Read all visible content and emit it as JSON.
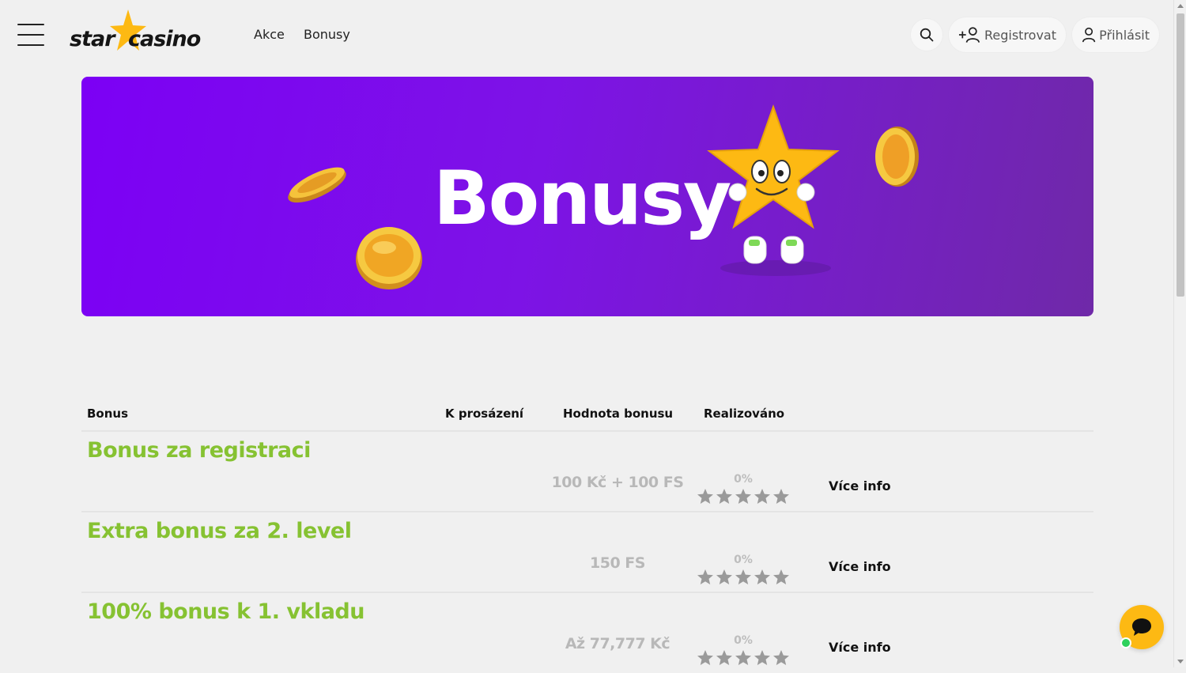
{
  "header": {
    "logo_part1": "star",
    "logo_part2": "casino",
    "nav": [
      "Akce",
      "Bonusy"
    ],
    "register_label": "Registrovat",
    "login_label": "Přihlásit",
    "icons": {
      "menu": "hamburger-menu-icon",
      "search": "search-icon",
      "register": "user-plus-icon",
      "login": "user-icon"
    }
  },
  "banner": {
    "title": "Bonusy"
  },
  "table": {
    "headers": [
      "Bonus",
      "K prosázení",
      "Hodnota bonusu",
      "Realizováno"
    ],
    "rows": [
      {
        "name": "Bonus za registraci",
        "value": "100 Kč + 100 FS",
        "realized": "0%",
        "rating_max": 5,
        "rating": 0,
        "more": "Více info"
      },
      {
        "name": "Extra bonus za 2. level",
        "value": "150 FS",
        "realized": "0%",
        "rating_max": 5,
        "rating": 0,
        "more": "Více info"
      },
      {
        "name": "100% bonus k 1. vkladu",
        "value": "Až 77,777 Kč",
        "realized": "0%",
        "rating_max": 5,
        "rating": 0,
        "more": "Více info"
      }
    ]
  },
  "colors": {
    "banner_start": "#7c00f5",
    "banner_end": "#6f29a8",
    "bonus_name": "#86c232",
    "logo_star": "#fdb913",
    "chat": "#fdb913",
    "online_dot": "#2ed15d"
  },
  "chat": {
    "icon": "chat-bubble-icon",
    "status": "online"
  }
}
